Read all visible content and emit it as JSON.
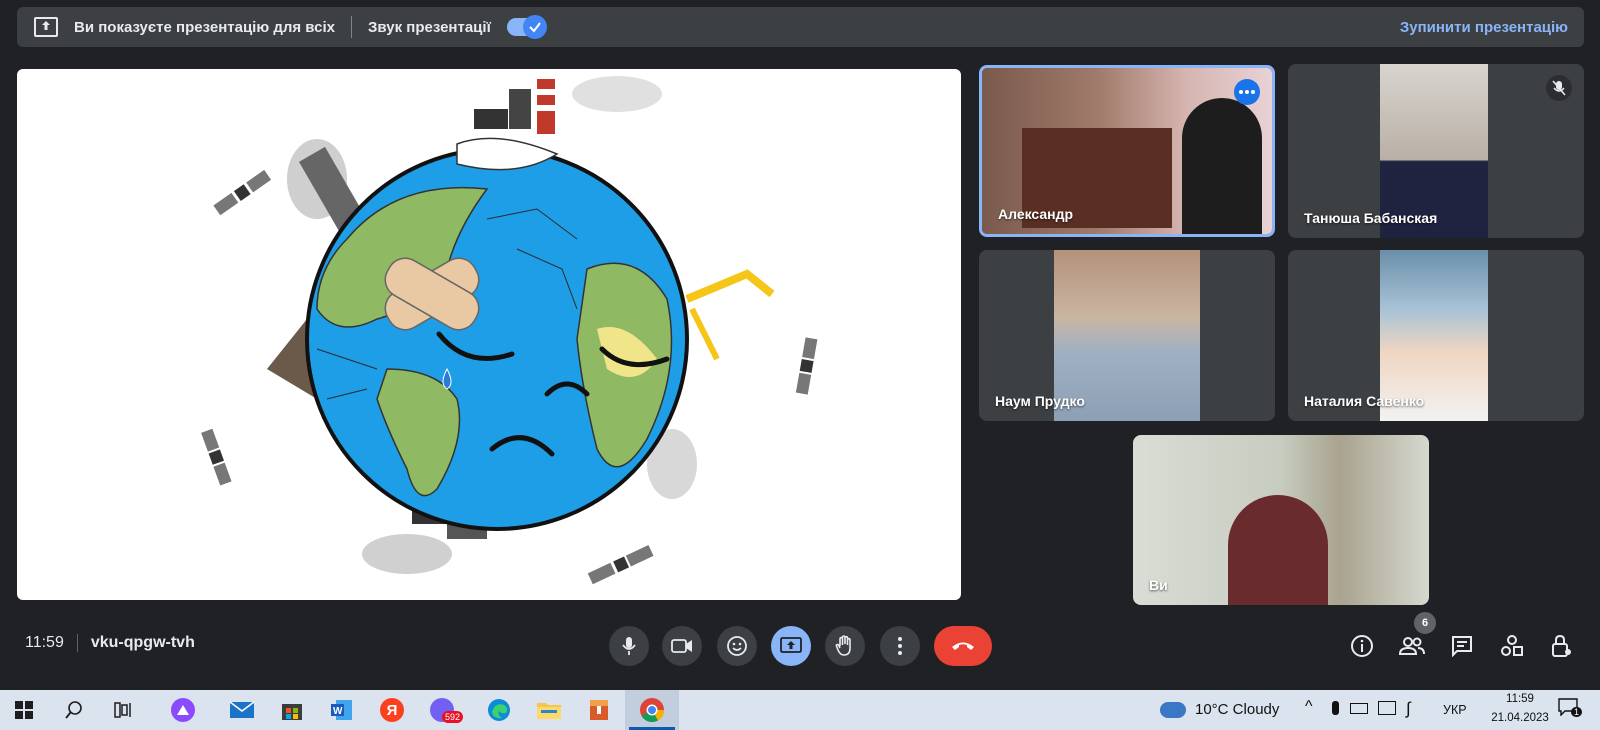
{
  "banner": {
    "present_text": "Ви показуєте презентацію для всіх",
    "sound_label": "Звук презентації",
    "stop_label": "Зупинити презентацію"
  },
  "participants": [
    {
      "name": "Александр"
    },
    {
      "name": "Танюша Бабанская"
    },
    {
      "name": "Наум Прудко"
    },
    {
      "name": "Наталия Савенко"
    },
    {
      "name": "Ви"
    }
  ],
  "meeting": {
    "time": "11:59",
    "code": "vku-qpgw-tvh",
    "people_count": "6"
  },
  "taskbar": {
    "weather": "10°C  Cloudy",
    "lang": "УКР",
    "time": "11:59",
    "date": "21.04.2023",
    "viber_badge": "592",
    "notif_count": "1"
  },
  "icons": {
    "present": "present-icon",
    "mic": "mic-icon",
    "camera": "camera-icon",
    "emoji": "emoji-icon",
    "present_now": "present-now-icon",
    "hand": "raise-hand-icon",
    "more": "more-vert-icon",
    "end": "end-call-icon"
  },
  "colors": {
    "accent": "#8ab4f8",
    "end_call": "#ea4335",
    "earth_ocean": "#1e9ee6",
    "earth_land": "#8fba63"
  }
}
